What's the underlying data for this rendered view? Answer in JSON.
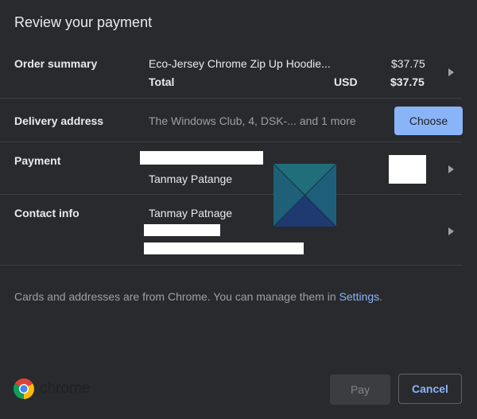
{
  "dialog": {
    "title": "Review your payment"
  },
  "order_summary": {
    "label": "Order summary",
    "item_name": "Eco-Jersey Chrome Zip Up Hoodie...",
    "item_price": "$37.75",
    "total_label": "Total",
    "currency": "USD",
    "total_price": "$37.75"
  },
  "delivery": {
    "label": "Delivery address",
    "value": "The Windows Club, 4, DSK-... and 1 more",
    "choose_label": "Choose"
  },
  "payment": {
    "label": "Payment",
    "card_holder": "Tanmay Patange"
  },
  "contact": {
    "label": "Contact info",
    "name": "Tanmay Patnage"
  },
  "footer": {
    "note": "Cards and addresses are from Chrome. You can manage them in ",
    "settings_link": "Settings",
    "note_end": ".",
    "brand": "chrome",
    "pay_label": "Pay",
    "cancel_label": "Cancel"
  },
  "colors": {
    "accent": "#8ab4f8",
    "background": "#292a2d"
  }
}
